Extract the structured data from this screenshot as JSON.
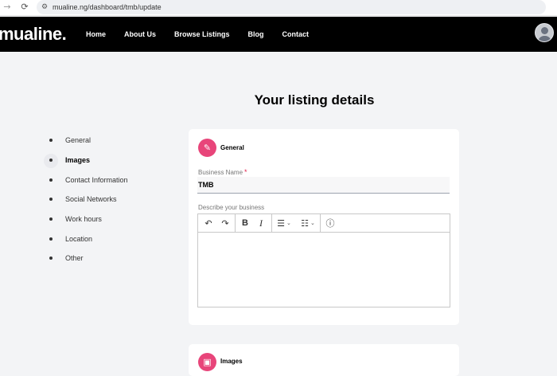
{
  "browser": {
    "url": "mualine.ng/dashboard/tmb/update",
    "back_icon": "arrow-left-icon",
    "reload_icon": "reload-icon"
  },
  "header": {
    "logo": "mualine.",
    "nav": [
      "Home",
      "About Us",
      "Browse Listings",
      "Blog",
      "Contact"
    ]
  },
  "page": {
    "title": "Your listing details"
  },
  "sidebar": {
    "items": [
      {
        "label": "General",
        "active": false
      },
      {
        "label": "Images",
        "active": true
      },
      {
        "label": "Contact Information",
        "active": false
      },
      {
        "label": "Social Networks",
        "active": false
      },
      {
        "label": "Work hours",
        "active": false
      },
      {
        "label": "Location",
        "active": false
      },
      {
        "label": "Other",
        "active": false
      }
    ]
  },
  "general_section": {
    "title": "General",
    "business_name_label": "Business Name",
    "required_mark": "*",
    "business_name_value": "TMB",
    "describe_label": "Describe your business",
    "describe_value": ""
  },
  "images_section": {
    "title": "Images"
  },
  "colors": {
    "accent": "#e8457a",
    "header_bg": "#000000",
    "page_bg": "#f3f4f6"
  }
}
